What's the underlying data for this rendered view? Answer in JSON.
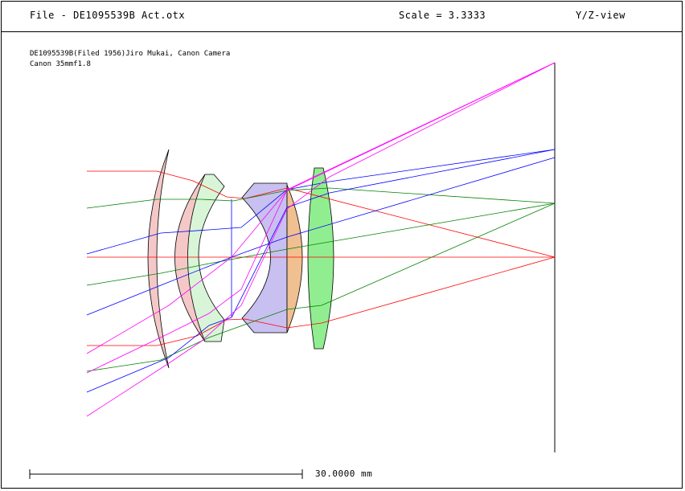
{
  "header": {
    "file_label": "File - DE1095539B Act.otx",
    "scale_label": "Scale = 3.3333",
    "view_label": "Y/Z-view"
  },
  "description": {
    "line1": "DE1095539B(Filed 1956)Jiro Mukai, Canon Camera",
    "line2": "Canon 35mmf1.8"
  },
  "scale_bar": {
    "label": "30.0000 mm"
  },
  "colors": {
    "ray_red": "#ff0000",
    "ray_green": "#008000",
    "ray_blue": "#0000ff",
    "ray_magenta": "#ff00ff",
    "lens_pink": "#f5c8c8",
    "lens_lightgreen": "#d8f5d8",
    "lens_lavender": "#c8c0f0",
    "lens_orange": "#f0c090",
    "lens_green": "#90ee90"
  }
}
